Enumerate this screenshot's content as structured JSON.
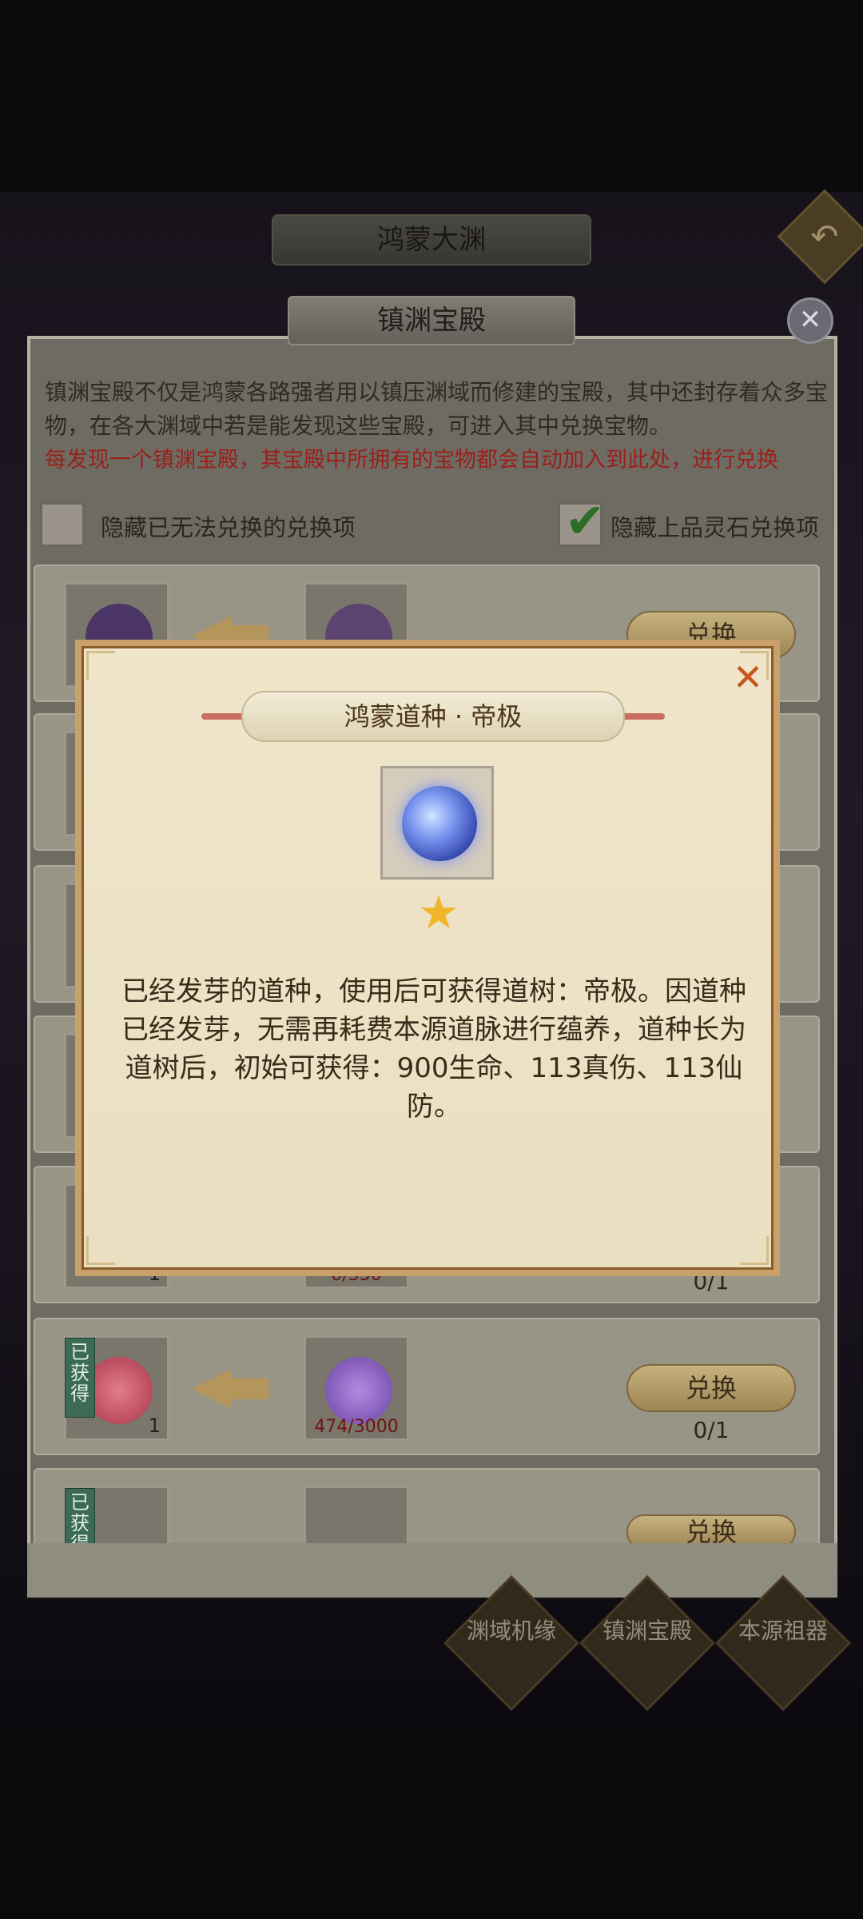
{
  "background": {
    "top_title": "鸿蒙大渊",
    "back_icon": "back-arrow-icon",
    "bottom_tabs": [
      {
        "label": "渊域机缘"
      },
      {
        "label": "镇渊宝殿"
      },
      {
        "label": "本源祖器"
      }
    ]
  },
  "panel": {
    "title": "镇渊宝殿",
    "description": "镇渊宝殿不仅是鸿蒙各路强者用以镇压渊域而修建的宝殿，其中还封存着众多宝物，在各大渊域中若是能发现这些宝殿，可进入其中兑换宝物。",
    "notice": "每发现一个镇渊宝殿，其宝殿中所拥有的宝物都会自动加入到此处，进行兑换",
    "filters": [
      {
        "label": "隐藏已无法兑换的兑换项",
        "checked": false
      },
      {
        "label": "隐藏上品灵石兑换项",
        "checked": true
      }
    ],
    "rows": [
      {
        "obtained": "",
        "count": "",
        "need": "",
        "button": "兑换",
        "progress": ""
      },
      {
        "obtained": "",
        "count": "",
        "need": "",
        "button": "",
        "progress": ""
      },
      {
        "obtained": "",
        "count": "",
        "need": "",
        "button": "",
        "progress": ""
      },
      {
        "obtained": "",
        "count": "",
        "need": "",
        "button": "",
        "progress": ""
      },
      {
        "obtained": "",
        "count": "1",
        "need": "0/350",
        "button": "",
        "progress": "0/1"
      },
      {
        "obtained": "已获得",
        "count": "1",
        "need": "474/3000",
        "button": "兑换",
        "progress": "0/1"
      },
      {
        "obtained": "已获得",
        "count": "",
        "need": "",
        "button": "兑换",
        "progress": ""
      }
    ]
  },
  "modal": {
    "title": "鸿蒙道种 · 帝极",
    "close_icon": "close-x-icon",
    "item_icon": "dao-seed-icon",
    "rarity_icon": "star-icon",
    "description": "已经发芽的道种，使用后可获得道树：帝极。因道种已经发芽，无需再耗费本源道脉进行蕴养，道种长为道树后，初始可获得：900生命、113真伤、113仙防。"
  },
  "colors": {
    "modal_bg": "#efe5cb",
    "modal_border": "#c9a06a",
    "accent_red": "#c9541c",
    "star": "#f0b62a"
  }
}
